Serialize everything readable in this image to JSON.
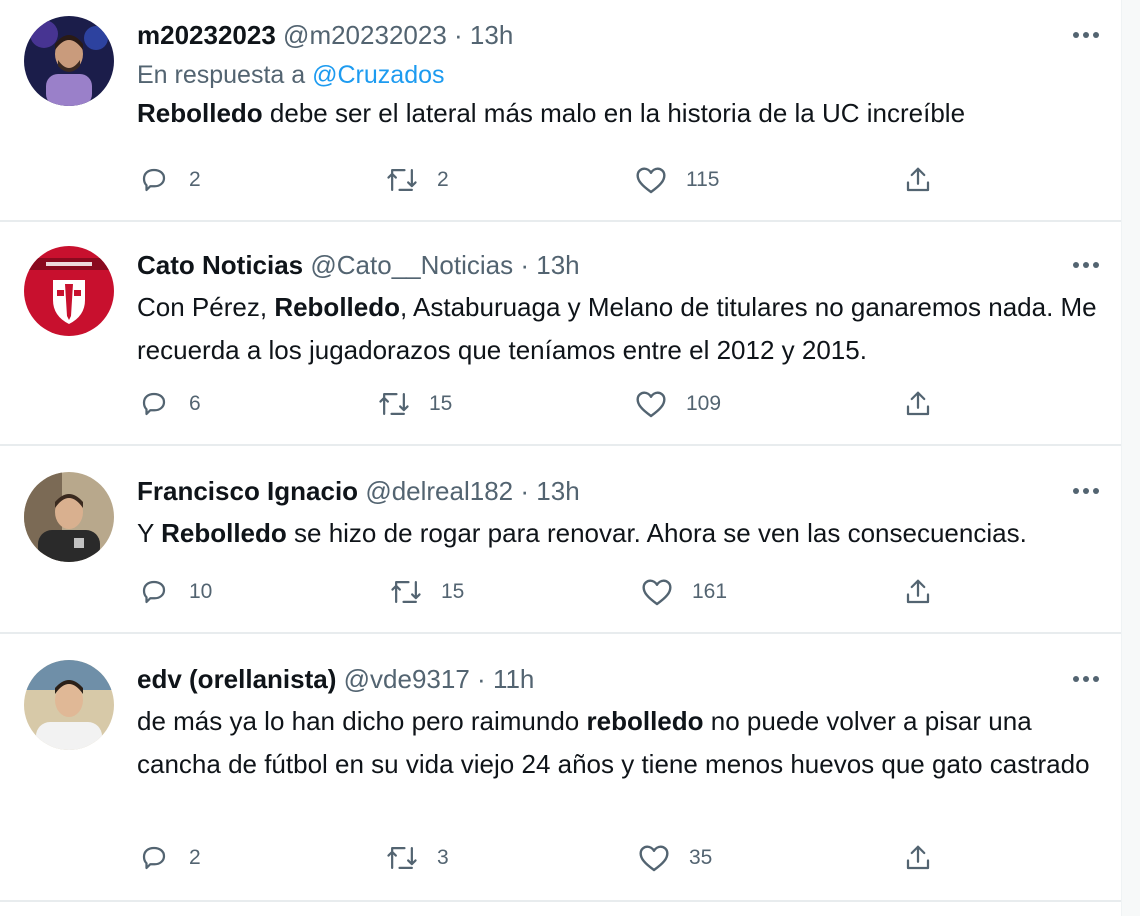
{
  "colors": {
    "text": "#0f1419",
    "secondary": "#536471",
    "accent": "#1d9bf0",
    "divider": "#e8ecee"
  },
  "tweets": [
    {
      "display_name": "m20232023",
      "handle": "@m20232023",
      "separator": "·",
      "time": "13h",
      "reply_prefix": "En respuesta a",
      "reply_to": "@Cruzados",
      "text_bold": "Rebolledo",
      "text_after": "debe ser el lateral más malo en la historia de la UC increíble",
      "replies": "2",
      "retweets": "2",
      "likes": "115",
      "icons": [
        "reply-icon",
        "retweet-icon",
        "like-icon",
        "share-icon",
        "more-icon"
      ]
    },
    {
      "display_name": "Cato Noticias",
      "handle": "@Cato__Noticias",
      "separator": "·",
      "time": "13h",
      "text_before": "Con Pérez,",
      "text_bold": "Rebolledo",
      "text_after": ", Astaburuaga y Melano de titulares no ganaremos nada. Me recuerda a los jugadorazos que teníamos entre el 2012 y 2015.",
      "replies": "6",
      "retweets": "15",
      "likes": "109"
    },
    {
      "display_name": "Francisco Ignacio",
      "handle": "@delreal182",
      "separator": "·",
      "time": "13h",
      "text_before": "Y",
      "text_bold": "Rebolledo",
      "text_after": "se hizo de rogar para renovar. Ahora se ven las consecuencias.",
      "replies": "10",
      "retweets": "15",
      "likes": "161"
    },
    {
      "display_name": "edv (orellanista)",
      "handle": "@vde9317",
      "separator": "·",
      "time": "11h",
      "text_before": "de más ya lo han dicho pero raimundo",
      "text_bold": "rebolledo",
      "text_after": "no puede volver a pisar una cancha de fútbol en su vida viejo 24 años y tiene menos huevos que gato castrado",
      "replies": "2",
      "retweets": "3",
      "likes": "35"
    }
  ]
}
